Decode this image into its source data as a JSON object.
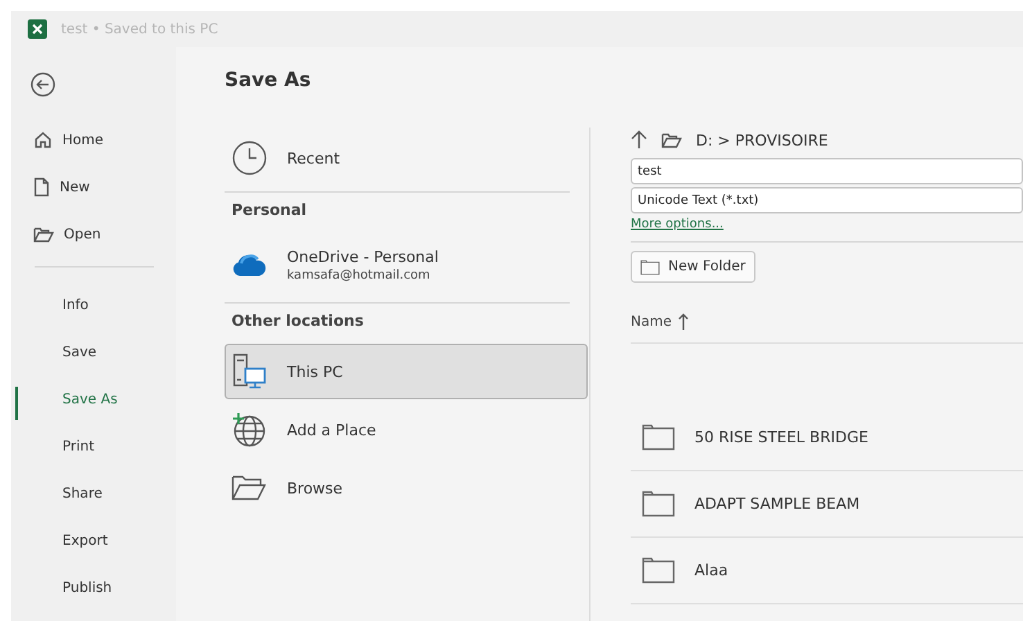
{
  "window": {
    "title": "test • Saved to this PC"
  },
  "sidebar": {
    "items": [
      {
        "label": "Home",
        "kind": "icon",
        "selected": false
      },
      {
        "label": "New",
        "kind": "icon",
        "selected": false
      },
      {
        "label": "Open",
        "kind": "icon",
        "selected": false
      },
      {
        "label": "Info",
        "kind": "plain",
        "selected": false
      },
      {
        "label": "Save",
        "kind": "plain",
        "selected": false
      },
      {
        "label": "Save As",
        "kind": "plain",
        "selected": true
      },
      {
        "label": "Print",
        "kind": "plain",
        "selected": false
      },
      {
        "label": "Share",
        "kind": "plain",
        "selected": false
      },
      {
        "label": "Export",
        "kind": "plain",
        "selected": false
      },
      {
        "label": "Publish",
        "kind": "plain",
        "selected": false
      }
    ]
  },
  "page_title": "Save As",
  "locations": [
    {
      "kind": "item",
      "label": "Recent",
      "selected": false
    },
    {
      "kind": "heading",
      "label": "Personal"
    },
    {
      "kind": "item",
      "label": "OneDrive - Personal",
      "sublabel": "kamsafa@hotmail.com",
      "selected": false
    },
    {
      "kind": "heading",
      "label": "Other locations"
    },
    {
      "kind": "item",
      "label": "This PC",
      "selected": true
    },
    {
      "kind": "item",
      "label": "Add a Place",
      "selected": false
    },
    {
      "kind": "item",
      "label": "Browse",
      "selected": false
    }
  ],
  "file_panel": {
    "path": "D: > PROVISOIRE",
    "file_name": "test",
    "file_type": "Unicode Text (*.txt)",
    "more_options": "More options...",
    "new_folder": "New Folder",
    "column": "Name",
    "rows": [
      {
        "name": "50 RISE STEEL BRIDGE"
      },
      {
        "name": "ADAPT SAMPLE BEAM"
      },
      {
        "name": "Alaa"
      }
    ]
  }
}
